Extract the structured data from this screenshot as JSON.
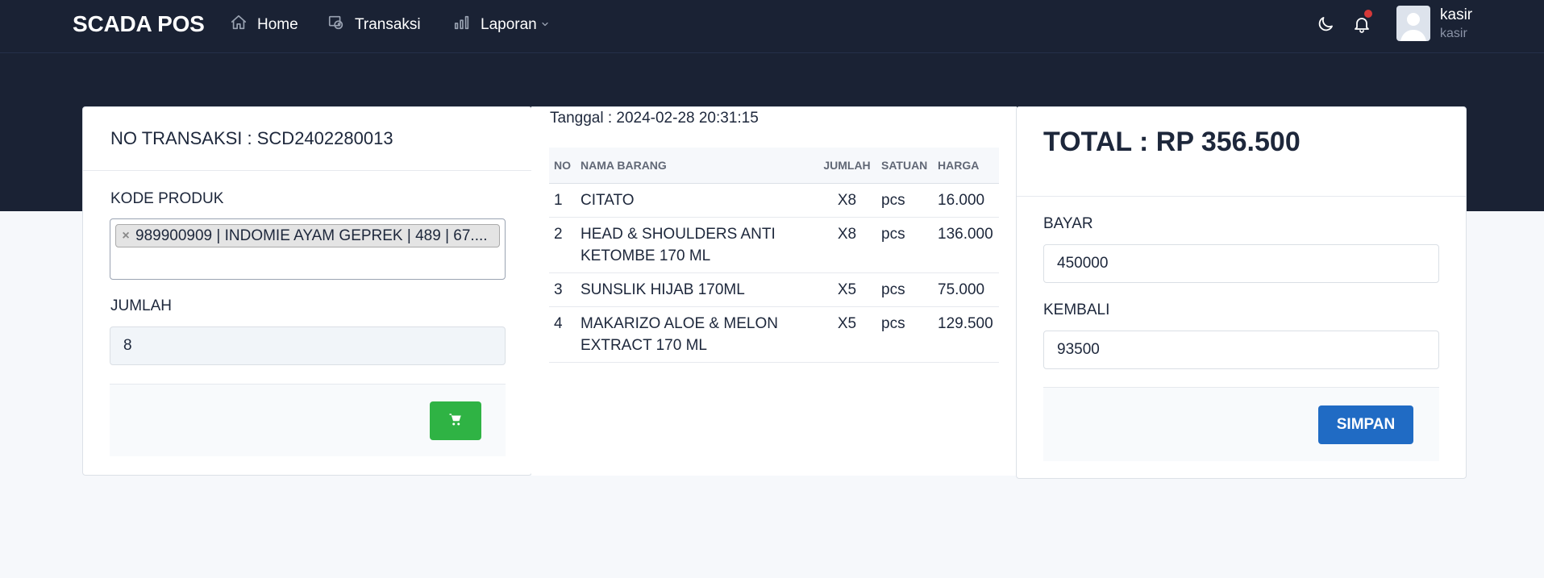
{
  "app": {
    "brand": "SCADA POS"
  },
  "nav": {
    "home": "Home",
    "transaksi": "Transaksi",
    "laporan": "Laporan"
  },
  "user": {
    "name": "kasir",
    "role": "kasir"
  },
  "colors": {
    "navbar": "#1a2234",
    "success": "#2fb344",
    "primary": "#206bc4",
    "notification": "#d63939"
  },
  "icons": [
    "home-icon",
    "transaction-icon",
    "chart-icon",
    "chevron-down-icon",
    "moon-icon",
    "bell-icon",
    "cart-icon"
  ],
  "left": {
    "no_transaksi": "NO TRANSAKSI : SCD2402280013",
    "kode_produk_label": "KODE PRODUK",
    "selected_product": "989900909 | INDOMIE AYAM GEPREK | 489 | 67....",
    "remove_symbol": "×",
    "jumlah_label": "JUMLAH",
    "jumlah_value": "8"
  },
  "middle": {
    "tanggal": "Tanggal : 2024-02-28 20:31:15",
    "columns": [
      "NO",
      "NAMA BARANG",
      "JUMLAH",
      "SATUAN",
      "HARGA"
    ],
    "rows": [
      {
        "no": "1",
        "nama": "CITATO",
        "jumlah": "X8",
        "satuan": "pcs",
        "harga": "16.000"
      },
      {
        "no": "2",
        "nama": "HEAD & SHOULDERS ANTI KETOMBE 170 ML",
        "jumlah": "X8",
        "satuan": "pcs",
        "harga": "136.000"
      },
      {
        "no": "3",
        "nama": "SUNSLIK HIJAB 170ML",
        "jumlah": "X5",
        "satuan": "pcs",
        "harga": "75.000"
      },
      {
        "no": "4",
        "nama": "MAKARIZO ALOE & MELON EXTRACT 170 ML",
        "jumlah": "X5",
        "satuan": "pcs",
        "harga": "129.500"
      }
    ]
  },
  "right": {
    "total": "TOTAL : RP 356.500",
    "bayar_label": "BAYAR",
    "bayar_value": "450000",
    "kembali_label": "KEMBALI",
    "kembali_value": "93500",
    "simpan": "SIMPAN"
  }
}
